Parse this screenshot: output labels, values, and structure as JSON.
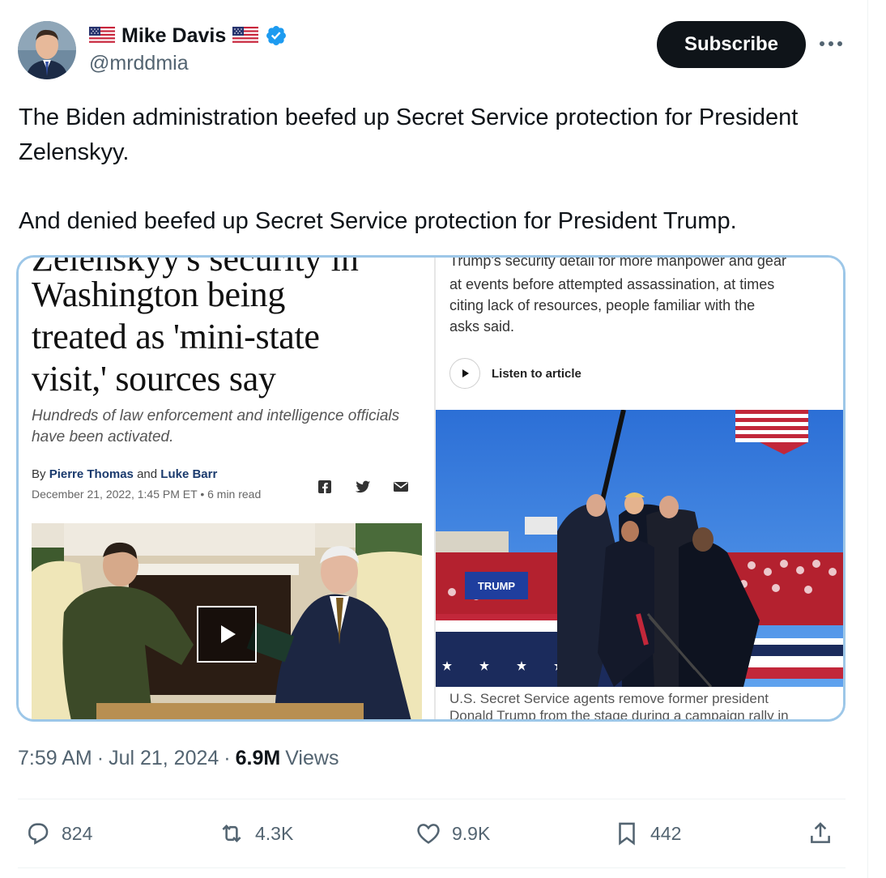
{
  "author": {
    "name": "Mike Davis",
    "handle": "@mrddmia",
    "flag_left": "🇺🇸",
    "flag_right": "🇺🇸",
    "verified_icon": "verified-badge-icon",
    "colors": {
      "verified": "#1d9bf0"
    }
  },
  "header": {
    "subscribe_label": "Subscribe",
    "more_icon": "more-dots-icon"
  },
  "tweet": {
    "paragraphs": [
      "The Biden administration beefed up Secret Service protection for President Zelenskyy.",
      "And denied beefed up Secret Service protection for President Trump."
    ]
  },
  "media": {
    "left": {
      "headline_cut": "Zelenskyy's security in",
      "headline_lines": [
        "Washington being",
        "treated as 'mini-state",
        "visit,' sources say"
      ],
      "subhead": "Hundreds of law enforcement and intelligence officials have been activated.",
      "byline_prefix": "By",
      "author1": "Pierre Thomas",
      "byline_and": "and",
      "author2": "Luke Barr",
      "date": "December 21, 2022, 1:45 PM ET",
      "read_time": "• 6 min read",
      "share_icons": [
        "facebook-icon",
        "twitter-icon",
        "email-icon"
      ],
      "play_icon": "play-icon"
    },
    "right": {
      "text_cut": "Trump's security detail for more manpower and gear",
      "text_lines": [
        "at events before attempted assassination, at times",
        "citing lack of resources, people familiar with the",
        "asks said."
      ],
      "listen_label": "Listen to article",
      "sign_text": "TRUMP",
      "caption_lines": [
        "U.S. Secret Service agents remove former president",
        "Donald Trump from the stage during a campaign rally in"
      ]
    }
  },
  "meta": {
    "time": "7:59 AM",
    "sep1": "·",
    "date": "Jul 21, 2024",
    "sep2": "·",
    "views_count": "6.9M",
    "views_label": "Views"
  },
  "actions": {
    "replies": "824",
    "reposts": "4.3K",
    "likes": "9.9K",
    "bookmarks": "442"
  }
}
